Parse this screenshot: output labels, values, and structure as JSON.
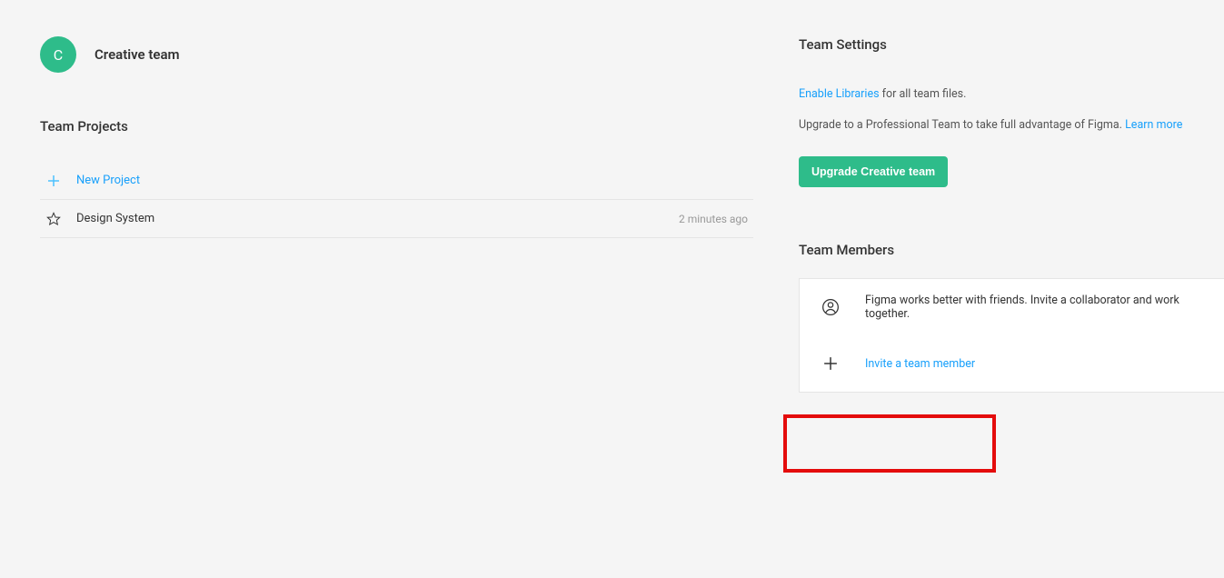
{
  "team": {
    "avatar_letter": "C",
    "name": "Creative team"
  },
  "projects": {
    "title": "Team Projects",
    "new_project_label": "New Project",
    "items": [
      {
        "label": "Design System",
        "time": "2 minutes ago"
      }
    ]
  },
  "settings": {
    "title": "Team Settings",
    "enable_libraries_link": "Enable Libraries",
    "enable_libraries_text": " for all team files.",
    "upgrade_text_prefix": "Upgrade to a Professional Team to take full advantage of Figma. ",
    "learn_more": "Learn more",
    "upgrade_button": "Upgrade Creative team"
  },
  "members": {
    "title": "Team Members",
    "hint": "Figma works better with friends. Invite a collaborator and work together.",
    "invite_label": "Invite a team member"
  }
}
